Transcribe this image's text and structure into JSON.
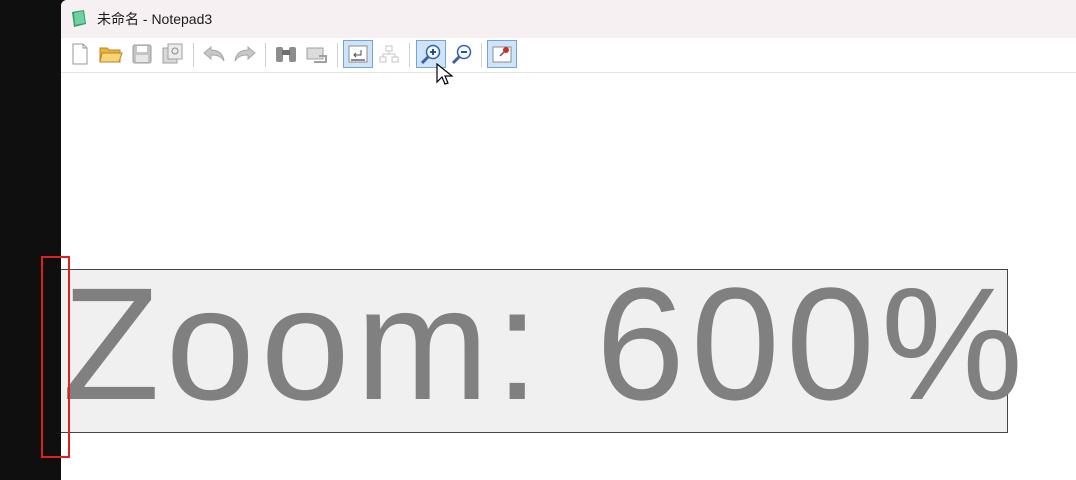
{
  "window": {
    "title": "未命名 - Notepad3"
  },
  "toolbar": {
    "buttons": [
      {
        "name": "new-file-button",
        "icon": "new-file-icon"
      },
      {
        "name": "open-file-button",
        "icon": "open-folder-icon"
      },
      {
        "name": "save-button",
        "icon": "save-icon"
      },
      {
        "name": "save-as-button",
        "icon": "save-as-icon"
      },
      {
        "name": "undo-button",
        "icon": "undo-icon"
      },
      {
        "name": "redo-button",
        "icon": "redo-icon"
      },
      {
        "name": "find-button",
        "icon": "binoculars-icon"
      },
      {
        "name": "replace-button",
        "icon": "replace-icon"
      },
      {
        "name": "word-wrap-button",
        "icon": "word-wrap-icon",
        "active": true
      },
      {
        "name": "folding-button",
        "icon": "tree-icon"
      },
      {
        "name": "zoom-in-button",
        "icon": "zoom-in-icon",
        "active": true
      },
      {
        "name": "zoom-out-button",
        "icon": "zoom-out-icon"
      },
      {
        "name": "pin-on-top-button",
        "icon": "pin-icon",
        "active": true
      }
    ]
  },
  "editor": {
    "zoom_label": "Zoom: 600%"
  },
  "colors": {
    "highlight": "#e02020",
    "active_button": "#cfe4f8"
  }
}
